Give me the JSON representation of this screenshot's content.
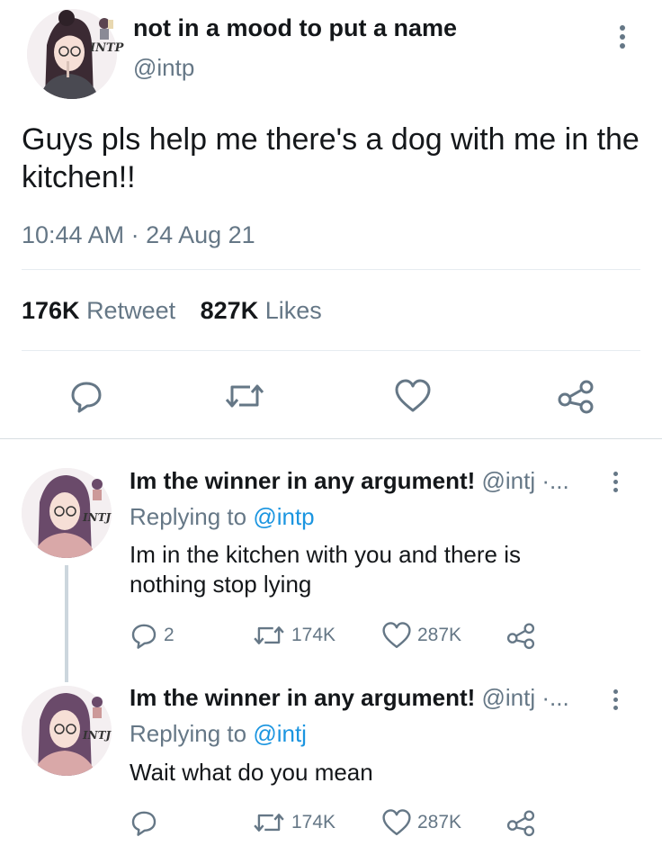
{
  "main_tweet": {
    "display_name": "not in a mood to put a name",
    "handle": "@intp",
    "avatar_tag": "INTP",
    "text": "Guys pls help me there's a dog with me in the kitchen!!",
    "timestamp": "10:44 AM · 24 Aug 21",
    "retweet_count": "176K",
    "retweet_label": "Retweet",
    "like_count": "827K",
    "like_label": "Likes"
  },
  "replies": [
    {
      "display_name": "Im the winner in any argument!",
      "handle_trunc": "@intj ·...",
      "avatar_tag": "INTJ",
      "replying_prefix": "Replying to ",
      "replying_to": "@intp",
      "text": "Im in the kitchen with you and there is nothing stop lying",
      "reply_count": "2",
      "retweet_count": "174K",
      "like_count": "287K"
    },
    {
      "display_name": "Im the winner in any argument!",
      "handle_trunc": "@intj ·...",
      "avatar_tag": "INTJ",
      "replying_prefix": "Replying to ",
      "replying_to": "@intj",
      "text": "Wait what do you mean",
      "reply_count": "",
      "retweet_count": "174K",
      "like_count": "287K"
    }
  ],
  "icons": {
    "reply": "reply-icon",
    "retweet": "retweet-icon",
    "like": "heart-icon",
    "share": "share-icon",
    "more": "more-vertical-icon"
  },
  "colors": {
    "text": "#14171a",
    "muted": "#657786",
    "link": "#1b95e0",
    "divider": "#e6ecf0"
  }
}
